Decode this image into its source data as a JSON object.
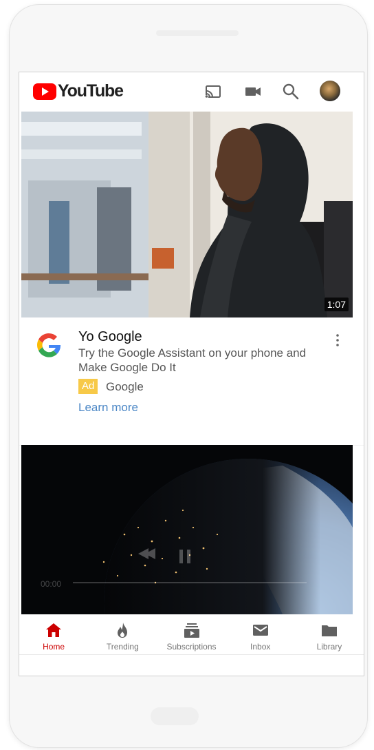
{
  "app": {
    "brand": "YouTube",
    "accent_color": "#ff0000"
  },
  "header": {
    "icons": [
      "cast-icon",
      "video-camera-icon",
      "search-icon",
      "account-avatar"
    ]
  },
  "feed": {
    "video1": {
      "duration": "1:07"
    },
    "ad": {
      "title": "Yo Google",
      "description": "Try the Google Assistant on your phone and Make Google Do It",
      "badge": "Ad",
      "advertiser": "Google",
      "cta": "Learn more",
      "badge_color": "#f7c948",
      "link_color": "#4a86c5"
    },
    "video2": {
      "current_time": "00:00"
    }
  },
  "bottom_nav": {
    "items": [
      {
        "label": "Home",
        "icon": "home-icon",
        "active": true
      },
      {
        "label": "Trending",
        "icon": "flame-icon",
        "active": false
      },
      {
        "label": "Subscriptions",
        "icon": "subscriptions-icon",
        "active": false
      },
      {
        "label": "Inbox",
        "icon": "mail-icon",
        "active": false
      },
      {
        "label": "Library",
        "icon": "folder-icon",
        "active": false
      }
    ],
    "active_color": "#cc0000"
  }
}
